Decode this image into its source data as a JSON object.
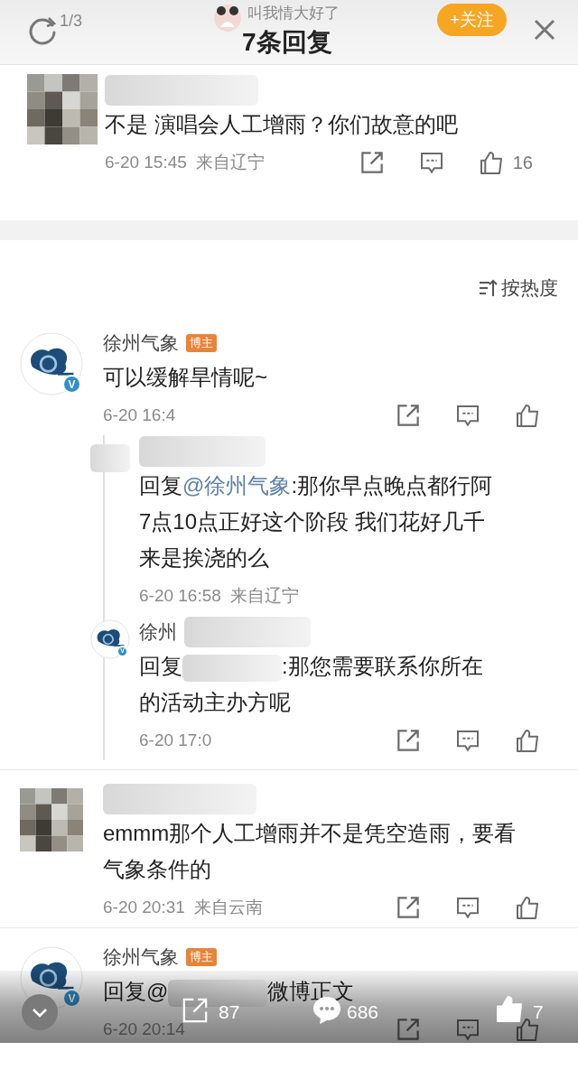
{
  "overlay_header": {
    "page_indicator": "1/3",
    "username": "叫我情大好了",
    "follow_button": "+关注"
  },
  "title": "7条回复",
  "root_comment": {
    "avatar": {
      "kind": "pixelated"
    },
    "name_blurred": true,
    "text_parts": [
      {
        "kind": "text",
        "text": "不是 演唱会人工增雨？你们故意的吧"
      }
    ],
    "time": "6-20 15:45",
    "location": "来自辽宁",
    "actions": true,
    "like_count": "16"
  },
  "sort": {
    "label": "按热度"
  },
  "comments": [
    {
      "avatar": {
        "kind": "logo",
        "verified_mark": "V"
      },
      "name": "徐州气象",
      "badge": "博主",
      "text_parts": [
        {
          "kind": "text",
          "text": "可以缓解旱情呢~"
        }
      ],
      "time": "6-20 16:4",
      "actions": true,
      "replies": [
        {
          "avatar": {
            "kind": "blurred"
          },
          "name_blurred": true,
          "text_parts": [
            {
              "kind": "text",
              "text": "回复"
            },
            {
              "kind": "mention",
              "text": "@徐州气象"
            },
            {
              "kind": "text",
              "text": ":那你早点晚点都行阿7点10点正好这个阶段 我们花好几千来是挨浇的么"
            }
          ],
          "time": "6-20 16:58",
          "location": "来自辽宁",
          "actions": false
        },
        {
          "avatar": {
            "kind": "logo",
            "verified_mark": "V"
          },
          "name": "徐州",
          "name_blurred": true,
          "text_parts": [
            {
              "kind": "text",
              "text": "回复"
            },
            {
              "kind": "blur"
            },
            {
              "kind": "text",
              "text": ":那您需要联系你所在的活动主办方呢"
            }
          ],
          "time": "6-20 17:0",
          "actions": true
        }
      ]
    },
    {
      "avatar": {
        "kind": "pixelated"
      },
      "name_blurred": true,
      "text_parts": [
        {
          "kind": "text",
          "text": "emmm那个人工增雨并不是凭空造雨，要看气象条件的"
        }
      ],
      "time": "6-20 20:31",
      "location": "来自云南",
      "actions": true
    },
    {
      "avatar": {
        "kind": "logo",
        "verified_mark": "V"
      },
      "name": "徐州气象",
      "badge": "博主",
      "text_parts": [
        {
          "kind": "text",
          "text": "回复@"
        },
        {
          "kind": "blur"
        },
        {
          "kind": "text",
          "text": "微博正文"
        }
      ],
      "time": "6-20 20:14",
      "actions": true
    }
  ],
  "bottom_bar": {
    "share_count": "87",
    "comment_count": "686",
    "like_count": "7"
  }
}
